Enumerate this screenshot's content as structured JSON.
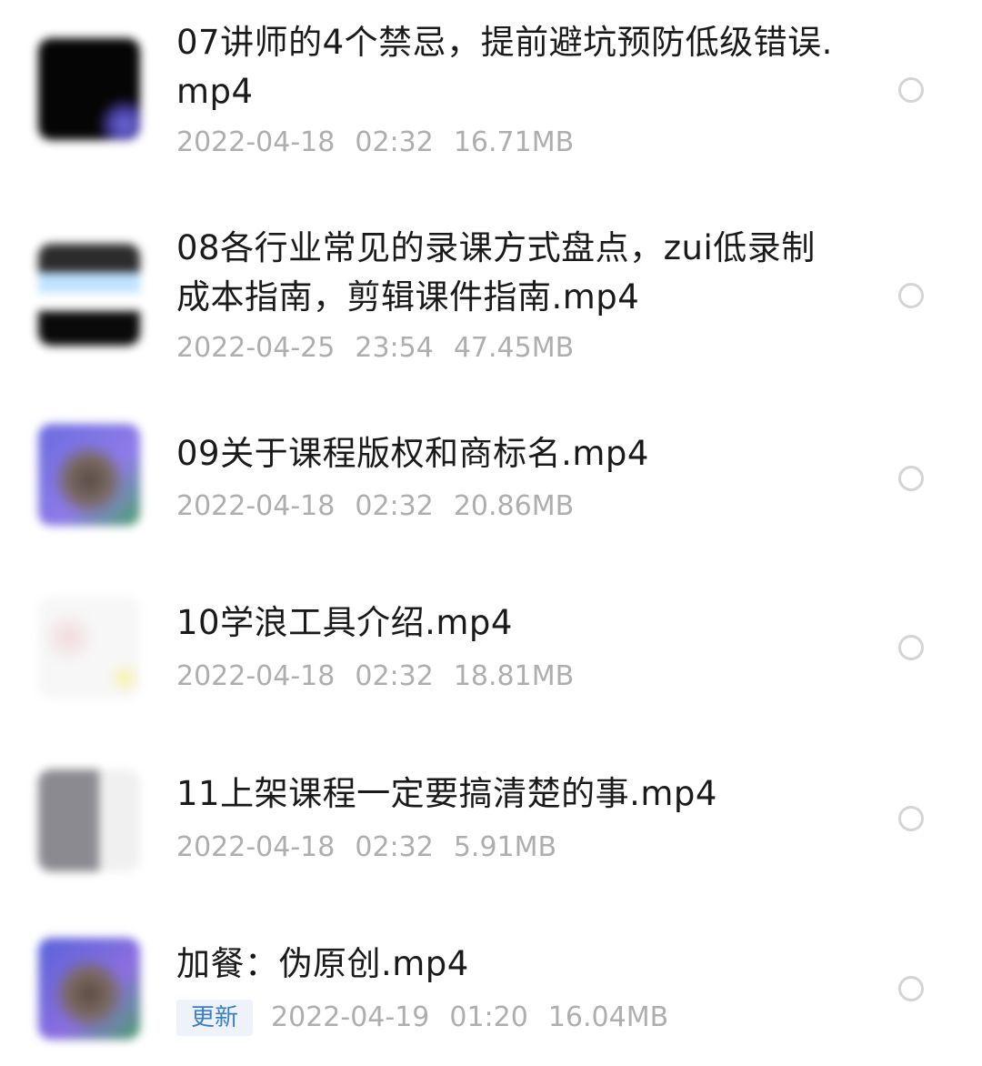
{
  "files": [
    {
      "title": "07讲师的4个禁忌，提前避坑预防低级错误.mp4",
      "date": "2022-04-18",
      "time": "02:32",
      "size": "16.71MB",
      "badge": ""
    },
    {
      "title": "08各行业常见的录课方式盘点，zui低录制成本指南，剪辑课件指南.mp4",
      "date": "2022-04-25",
      "time": "23:54",
      "size": "47.45MB",
      "badge": ""
    },
    {
      "title": "09关于课程版权和商标名.mp4",
      "date": "2022-04-18",
      "time": "02:32",
      "size": "20.86MB",
      "badge": ""
    },
    {
      "title": "10学浪工具介绍.mp4",
      "date": "2022-04-18",
      "time": "02:32",
      "size": "18.81MB",
      "badge": ""
    },
    {
      "title": "11上架课程一定要搞清楚的事.mp4",
      "date": "2022-04-18",
      "time": "02:32",
      "size": "5.91MB",
      "badge": ""
    },
    {
      "title": "加餐：伪原创.mp4",
      "date": "2022-04-19",
      "time": "01:20",
      "size": "16.04MB",
      "badge": "更新"
    }
  ]
}
